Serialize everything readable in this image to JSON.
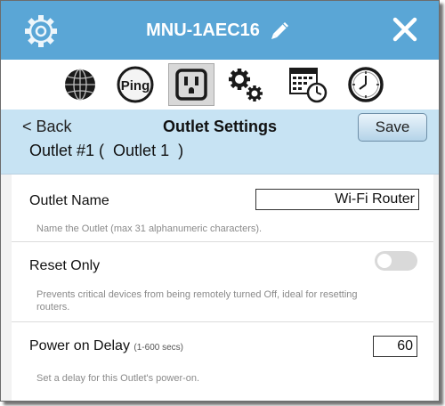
{
  "window": {
    "title": "MNU-1AEC16",
    "colors": {
      "titlebar": "#5aa6d6",
      "header": "#c7e3f3",
      "toggle_off": "#d9d9d9"
    }
  },
  "tabs": [
    {
      "icon": "globe-icon"
    },
    {
      "icon": "ping-icon",
      "label": "Ping"
    },
    {
      "icon": "outlet-icon",
      "active": true
    },
    {
      "icon": "gears-icon"
    },
    {
      "icon": "schedule-calendar-icon"
    },
    {
      "icon": "clock-icon"
    }
  ],
  "header": {
    "back_label": "< Back",
    "title": "Outlet Settings",
    "save_label": "Save",
    "outlet_line": "Outlet #1 (  Outlet 1  )"
  },
  "settings": {
    "outlet_name": {
      "label": "Outlet Name",
      "value": "Wi-Fi Router",
      "help": "Name the Outlet (max 31 alphanumeric characters)."
    },
    "reset_only": {
      "label": "Reset Only",
      "enabled": false,
      "help_line1": "Prevents critical devices from being remotely turned Off, ideal for resetting",
      "help_line2": "routers."
    },
    "power_on_delay": {
      "label": "Power on Delay",
      "range": "(1-600 secs)",
      "value": "60",
      "help": "Set a delay for this Outlet's power-on."
    }
  }
}
